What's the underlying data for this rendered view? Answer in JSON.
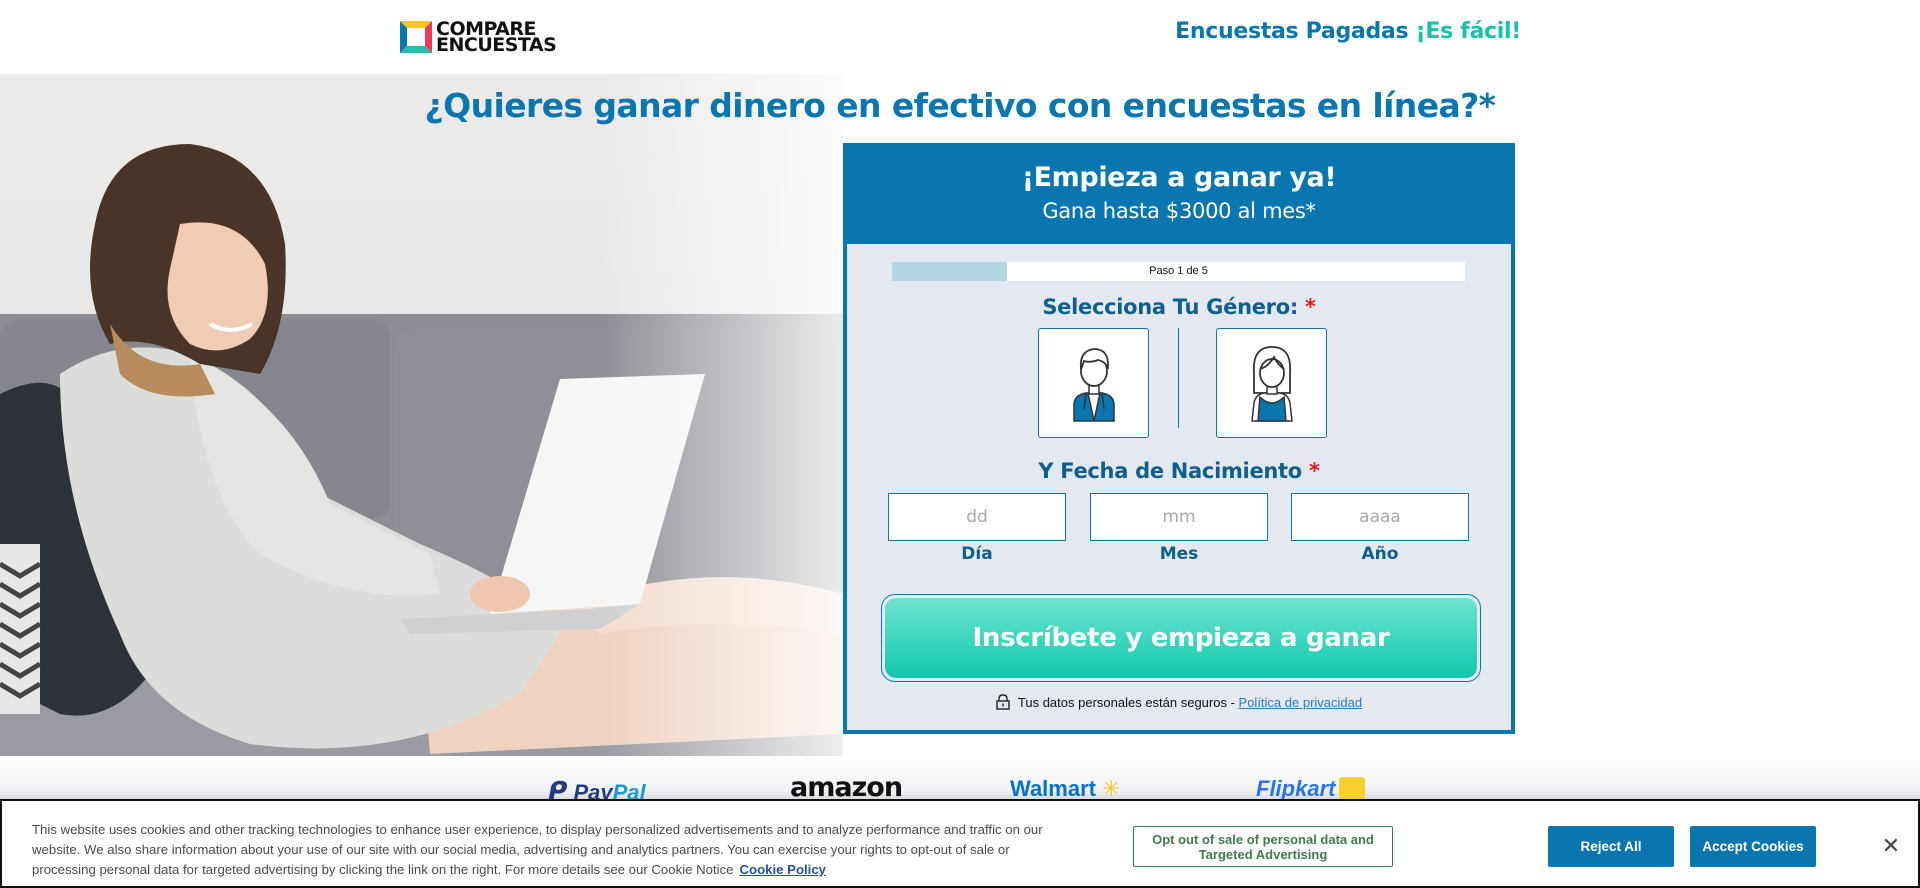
{
  "header": {
    "logo_line1": "COMPARE",
    "logo_line2": "ENCUESTAS",
    "tagline_part1": "Encuestas Pagadas ",
    "tagline_part2": "¡Es fácil!"
  },
  "hero": {
    "headline": "¿Quieres ganar dinero en efectivo con encuestas en línea?*",
    "image_alt": "woman-using-laptop-on-sofa"
  },
  "form": {
    "title": "¡Empieza a ganar ya!",
    "subtitle": "Gana hasta $3000 al mes*",
    "progress": {
      "current_step": 1,
      "total_steps": 5,
      "label": "Paso 1 de 5",
      "fraction": 0.2
    },
    "gender_label": "Selecciona Tu Género:",
    "required_mark": "*",
    "gender_options": [
      {
        "value": "male",
        "icon": "male-avatar-icon"
      },
      {
        "value": "female",
        "icon": "female-avatar-icon"
      }
    ],
    "birthdate_label": "Y Fecha de Nacimiento",
    "day": {
      "placeholder": "dd",
      "value": "",
      "label": "Día"
    },
    "month": {
      "placeholder": "mm",
      "value": "",
      "label": "Mes"
    },
    "year": {
      "placeholder": "aaaa",
      "value": "",
      "label": "Año"
    },
    "submit_label": "Inscríbete y empieza a ganar",
    "secure_text": "Tus datos personales están seguros - ",
    "privacy_link": "Política de privacidad"
  },
  "brands": {
    "paypal_a": "Pay",
    "paypal_b": "Pal",
    "amazon": "amazon",
    "walmart": "Walmart",
    "walmart_spark": "✳",
    "flipkart": "Flipkart"
  },
  "cookie_banner": {
    "text": "This website uses cookies and other tracking technologies to enhance user experience, to display personalized advertisements and to analyze performance and traffic on our website. We also share information about your use of our site with our social media, advertising and analytics partners. You can exercise your rights to opt-out of sale or processing personal data for targeted advertising by clicking the link on the right. For more details see our Cookie Notice",
    "policy_link": "Cookie Policy",
    "opt_out_label": "Opt out of sale of personal data and Targeted Advertising",
    "reject_label": "Reject All",
    "accept_label": "Accept Cookies",
    "close_label": "✕"
  },
  "colors": {
    "brand_blue": "#0a76b0",
    "accent_teal": "#14c3a8",
    "form_bg": "#e4e8f1",
    "required_red": "#e21b1b"
  }
}
